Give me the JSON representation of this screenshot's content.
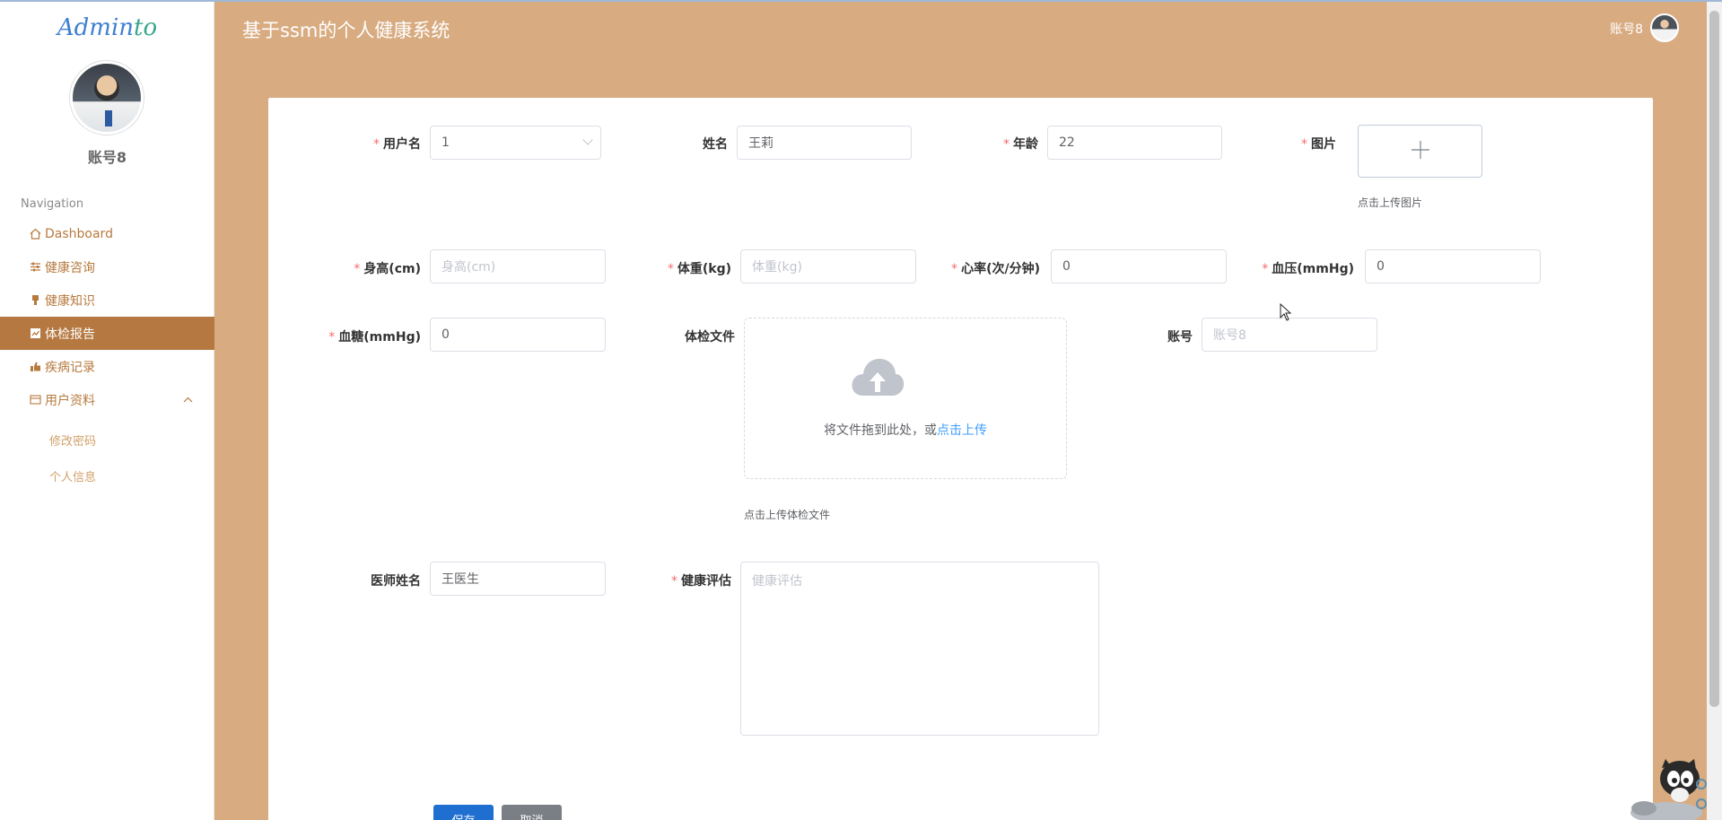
{
  "brand": {
    "part1": "Admin",
    "part2": "to"
  },
  "sidebar": {
    "username": "账号8",
    "nav_title": "Navigation",
    "items": [
      {
        "label": "Dashboard",
        "icon": "home-icon"
      },
      {
        "label": "健康咨询",
        "icon": "sliders-icon"
      },
      {
        "label": "健康知识",
        "icon": "marker-icon"
      },
      {
        "label": "体检报告",
        "icon": "chart-icon",
        "active": true
      },
      {
        "label": "疾病记录",
        "icon": "thumb-icon"
      },
      {
        "label": "用户资料",
        "icon": "card-icon",
        "expanded": true
      }
    ],
    "sub_items": [
      {
        "label": "修改密码"
      },
      {
        "label": "个人信息"
      }
    ]
  },
  "header": {
    "title": "基于ssm的个人健康系统",
    "user": "账号8"
  },
  "form": {
    "username": {
      "label": "用户名",
      "value": "1"
    },
    "name": {
      "label": "姓名",
      "value": "王莉"
    },
    "age": {
      "label": "年龄",
      "value": "22"
    },
    "image": {
      "label": "图片",
      "tip": "点击上传图片"
    },
    "height": {
      "label": "身高(cm)",
      "placeholder": "身高(cm)"
    },
    "weight": {
      "label": "体重(kg)",
      "placeholder": "体重(kg)"
    },
    "heart_rate": {
      "label": "心率(次/分钟)",
      "value": "0"
    },
    "blood_pressure": {
      "label": "血压(mmHg)",
      "value": "0"
    },
    "blood_sugar": {
      "label": "血糖(mmHg)",
      "value": "0"
    },
    "file": {
      "label": "体检文件",
      "drag_text": "将文件拖到此处，或",
      "drag_link": "点击上传",
      "tip": "点击上传体检文件"
    },
    "account": {
      "label": "账号",
      "placeholder": "账号8"
    },
    "doctor": {
      "label": "医师姓名",
      "value": "王医生"
    },
    "evaluation": {
      "label": "健康评估",
      "placeholder": "健康评估"
    },
    "save_label": "保存",
    "cancel_label": "取消"
  },
  "colors": {
    "accent": "#b57840",
    "header_bg": "#d8ab80",
    "link": "#409eff",
    "required": "#f56c6c"
  }
}
